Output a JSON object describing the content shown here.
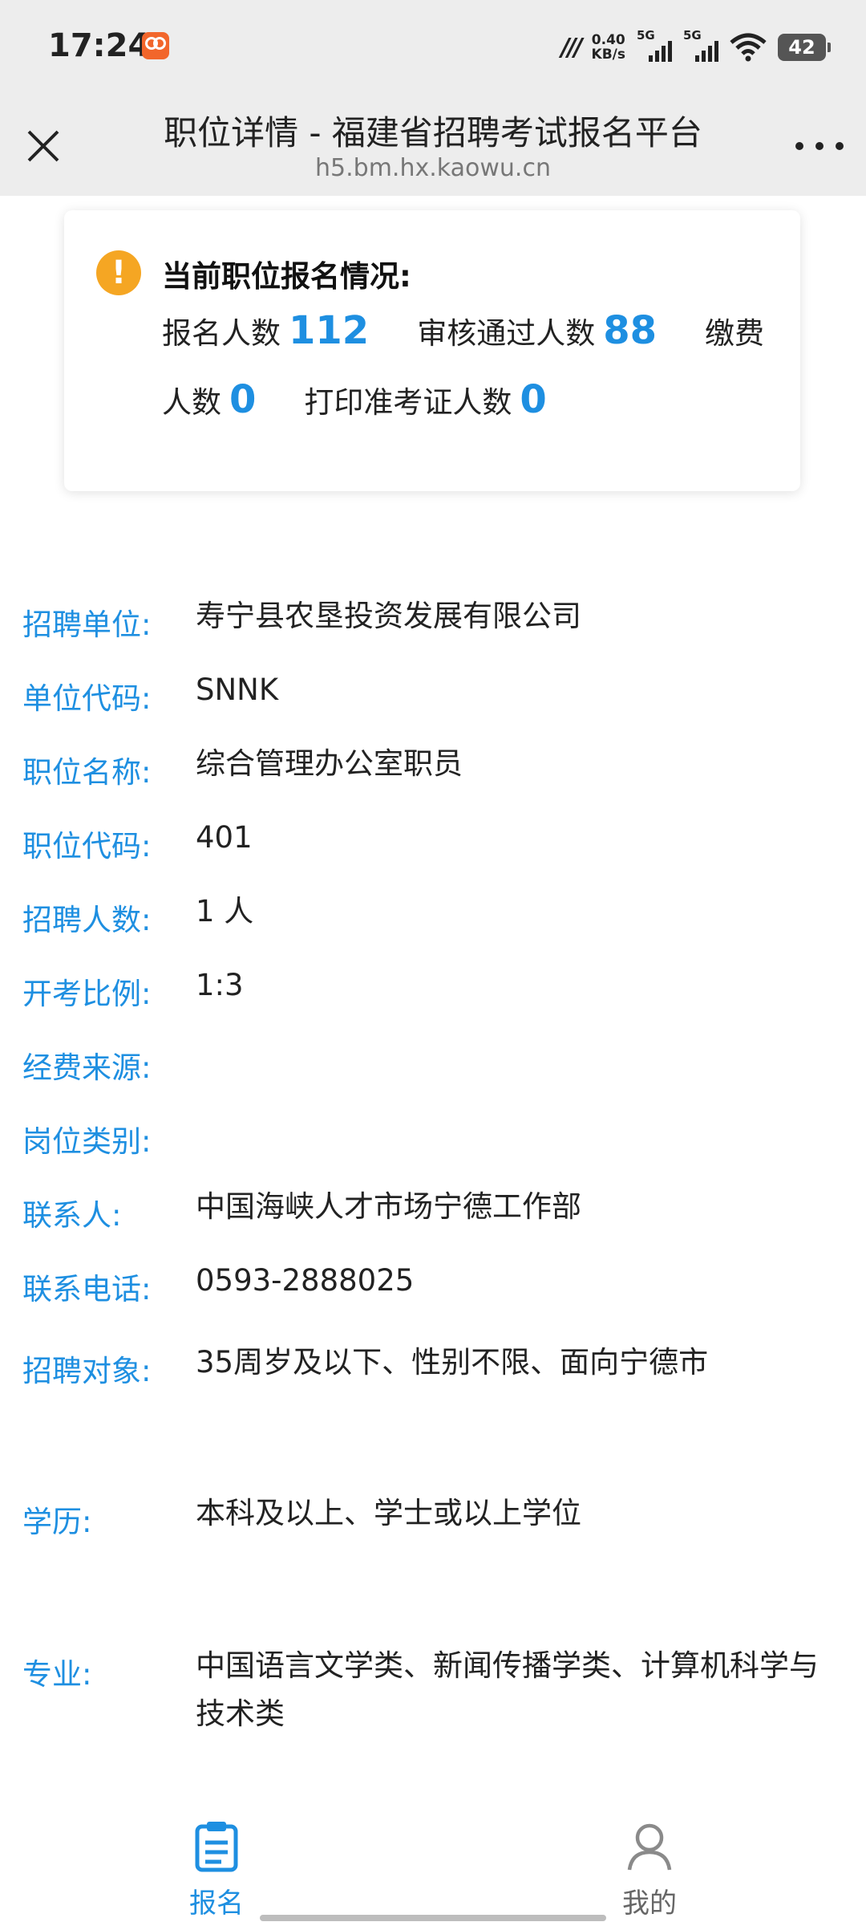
{
  "status_bar": {
    "time": "17:24",
    "network_speed_value": "0.40",
    "network_speed_unit": "KB/s",
    "sim1_label": "5G",
    "sim2_label": "5G",
    "battery": "42"
  },
  "header": {
    "title": "职位详情 - 福建省招聘考试报名平台",
    "url": "h5.bm.hx.kaowu.cn"
  },
  "stats_card": {
    "title": "当前职位报名情况:",
    "registered_label": "报名人数",
    "registered_value": "112",
    "approved_label": "审核通过人数",
    "approved_value": "88",
    "paid_label_part1": "缴费",
    "paid_label_part2": "人数",
    "paid_value": "0",
    "printed_label": "打印准考证人数",
    "printed_value": "0"
  },
  "details": [
    {
      "label": "招聘单位:",
      "value": "寿宁县农垦投资发展有限公司"
    },
    {
      "label": "单位代码:",
      "value": "SNNK"
    },
    {
      "label": "职位名称:",
      "value": "综合管理办公室职员"
    },
    {
      "label": "职位代码:",
      "value": "401"
    },
    {
      "label": "招聘人数:",
      "value": "1 人"
    },
    {
      "label": "开考比例:",
      "value": "1:3"
    },
    {
      "label": "经费来源:",
      "value": ""
    },
    {
      "label": "岗位类别:",
      "value": ""
    },
    {
      "label": "联系人:",
      "value": "中国海峡人才市场宁德工作部"
    },
    {
      "label": "联系电话:",
      "value": "0593-2888025"
    },
    {
      "label": "招聘对象:",
      "value": "35周岁及以下、性别不限、面向宁德市"
    },
    {
      "label": "学历:",
      "value": "本科及以上、学士或以上学位"
    },
    {
      "label": "专业:",
      "value": "中国语言文学类、新闻传播学类、计算机科学与技术类"
    }
  ],
  "bottom_nav": {
    "signup_label": "报名",
    "mine_label": "我的"
  },
  "colors": {
    "accent": "#1e8fe1",
    "warning": "#f5a623",
    "header_bg": "#ededed"
  }
}
